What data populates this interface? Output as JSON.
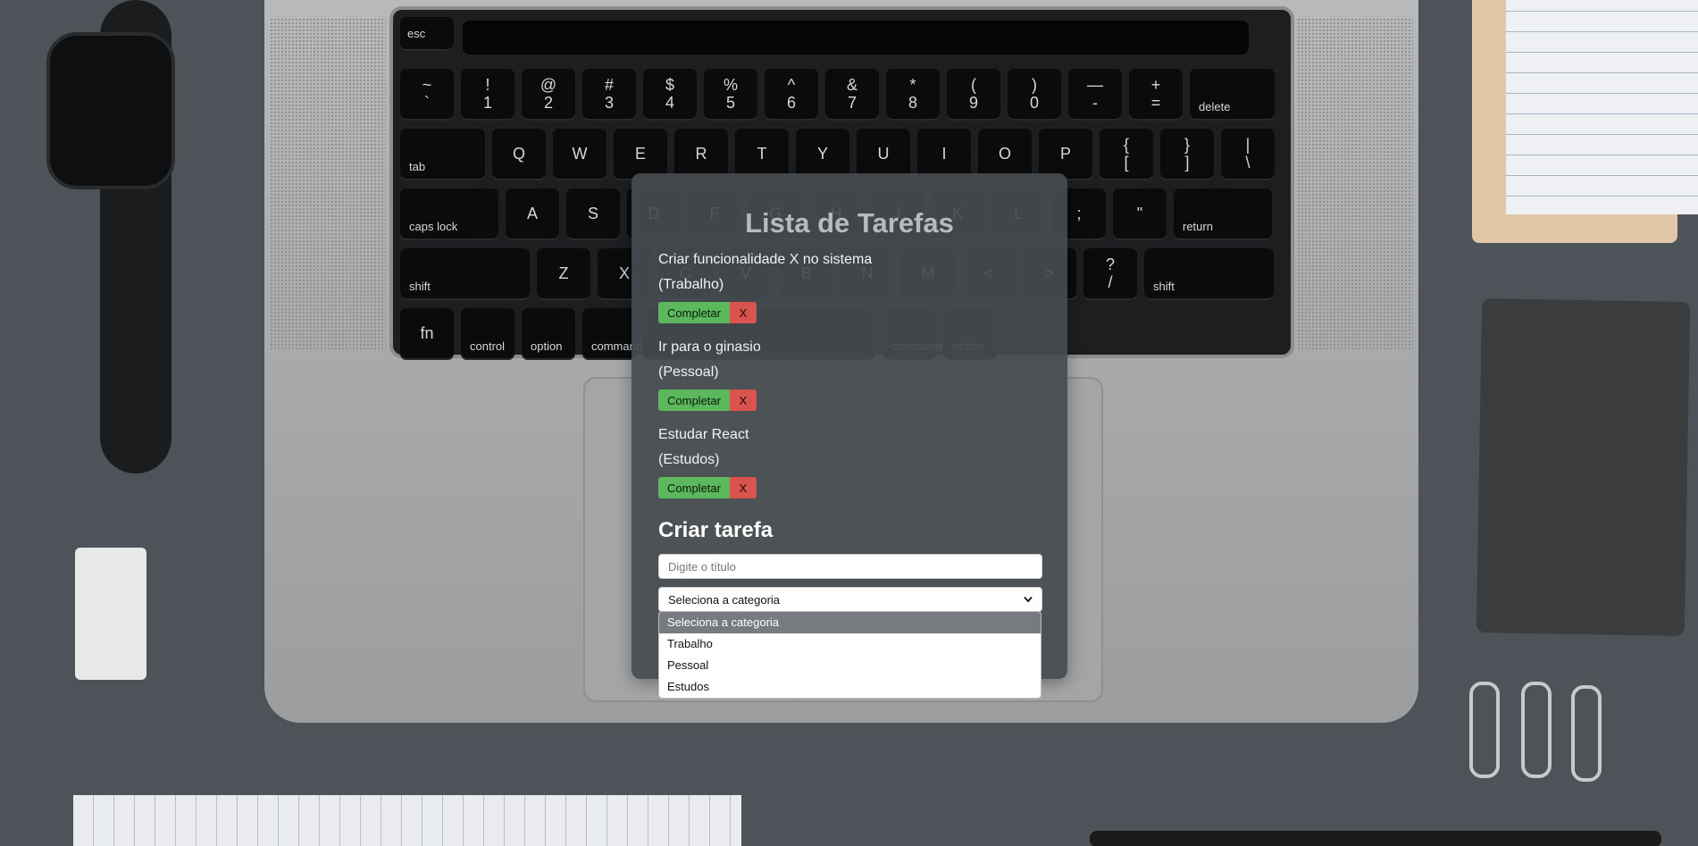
{
  "app": {
    "title": "Lista de Tarefas",
    "tasks": [
      {
        "title": "Criar funcionalidade X no sistema",
        "category": "(Trabalho)",
        "complete_label": "Completar",
        "delete_label": "X"
      },
      {
        "title": "Ir para o ginasio",
        "category": "(Pessoal)",
        "complete_label": "Completar",
        "delete_label": "X"
      },
      {
        "title": "Estudar React",
        "category": "(Estudos)",
        "complete_label": "Completar",
        "delete_label": "X"
      }
    ],
    "create": {
      "heading": "Criar tarefa",
      "title_placeholder": "Digite o título",
      "category_selected": "Seleciona a categoria",
      "category_options": [
        "Seleciona a categoria",
        "Trabalho",
        "Pessoal",
        "Estudos"
      ]
    },
    "colors": {
      "complete_button": "#5cb85c",
      "delete_button": "#d9534f",
      "panel": "#464b50"
    }
  },
  "keyboard": {
    "row_numbers": [
      "~\n`",
      "!\n1",
      "@\n2",
      "#\n3",
      "$\n4",
      "%\n5",
      "^\n6",
      "&\n7",
      "*\n8",
      "(\n9",
      ")\n0",
      "—\n-",
      "+\n=",
      "delete"
    ],
    "row_qwerty": [
      "tab",
      "Q",
      "W",
      "E",
      "R",
      "T",
      "Y",
      "U",
      "I",
      "O",
      "P",
      "{\n[",
      "}\n]",
      "|\n\\"
    ],
    "row_home": [
      "caps lock",
      "A",
      "S",
      "D",
      "F",
      "G",
      "H",
      "J",
      "K",
      "L",
      ";",
      "\"",
      "return"
    ],
    "row_shift": [
      "shift",
      "Z",
      "X",
      "C",
      "V",
      "B",
      "N",
      "M",
      "<",
      ">",
      "?\n/",
      "shift"
    ],
    "row_bottom": [
      "fn",
      "control",
      "option",
      "command",
      "",
      "command",
      "option"
    ],
    "esc": "esc"
  }
}
